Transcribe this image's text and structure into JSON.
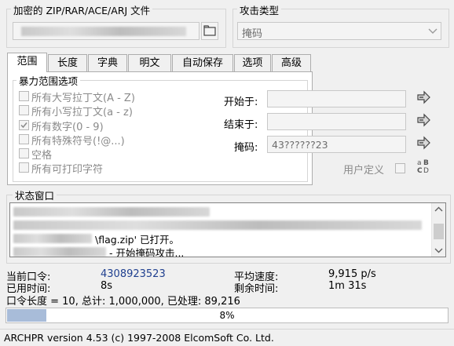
{
  "file_group": {
    "label": "加密的 ZIP/RAR/ACE/ARJ 文件"
  },
  "attack_group": {
    "label": "攻击类型",
    "selected": "掩码"
  },
  "tabs": [
    {
      "label": "范围"
    },
    {
      "label": "长度"
    },
    {
      "label": "字典"
    },
    {
      "label": "明文"
    },
    {
      "label": "自动保存"
    },
    {
      "label": "选项"
    },
    {
      "label": "高级"
    }
  ],
  "brute_force": {
    "group_label": "暴力范围选项",
    "options": [
      {
        "label": "所有大写拉丁文(A - Z)",
        "checked": false
      },
      {
        "label": "所有小写拉丁文(a - z)",
        "checked": false
      },
      {
        "label": "所有数字(0 - 9)",
        "checked": true
      },
      {
        "label": "所有特殊符号(!@...)",
        "checked": false
      },
      {
        "label": "空格",
        "checked": false
      },
      {
        "label": "所有可打印字符",
        "checked": false
      }
    ],
    "start_label": "开始于:",
    "end_label": "结束于:",
    "mask_label": "掩码:",
    "mask_value": "43??????23",
    "user_defined_label": "用户定义"
  },
  "status_window": {
    "label": "状态窗口",
    "lines": [
      {
        "text": ""
      },
      {
        "text": ""
      },
      {
        "text": "\\flag.zip' 已打开。"
      },
      {
        "text": "- 开始掩码攻击..."
      }
    ]
  },
  "stats": {
    "current_password_label": "当前口令:",
    "current_password_value": "4308923523",
    "avg_speed_label": "平均速度:",
    "avg_speed_value": "9,915 p/s",
    "elapsed_label": "已用时间:",
    "elapsed_value": "8s",
    "remaining_label": "剩余时间:",
    "remaining_value": "1m 31s",
    "summary": "口令长度 = 10, 总计: 1,000,000, 已处理: 89,216"
  },
  "progress": {
    "percent_text": "8%",
    "fraction": 0.089
  },
  "statusbar": {
    "text": "ARCHPR version 4.53 (c) 1997-2008 ElcomSoft Co. Ltd."
  },
  "colors": {
    "value_blue": "#1f3f8f",
    "progress_fill": "#a8bcd9"
  }
}
